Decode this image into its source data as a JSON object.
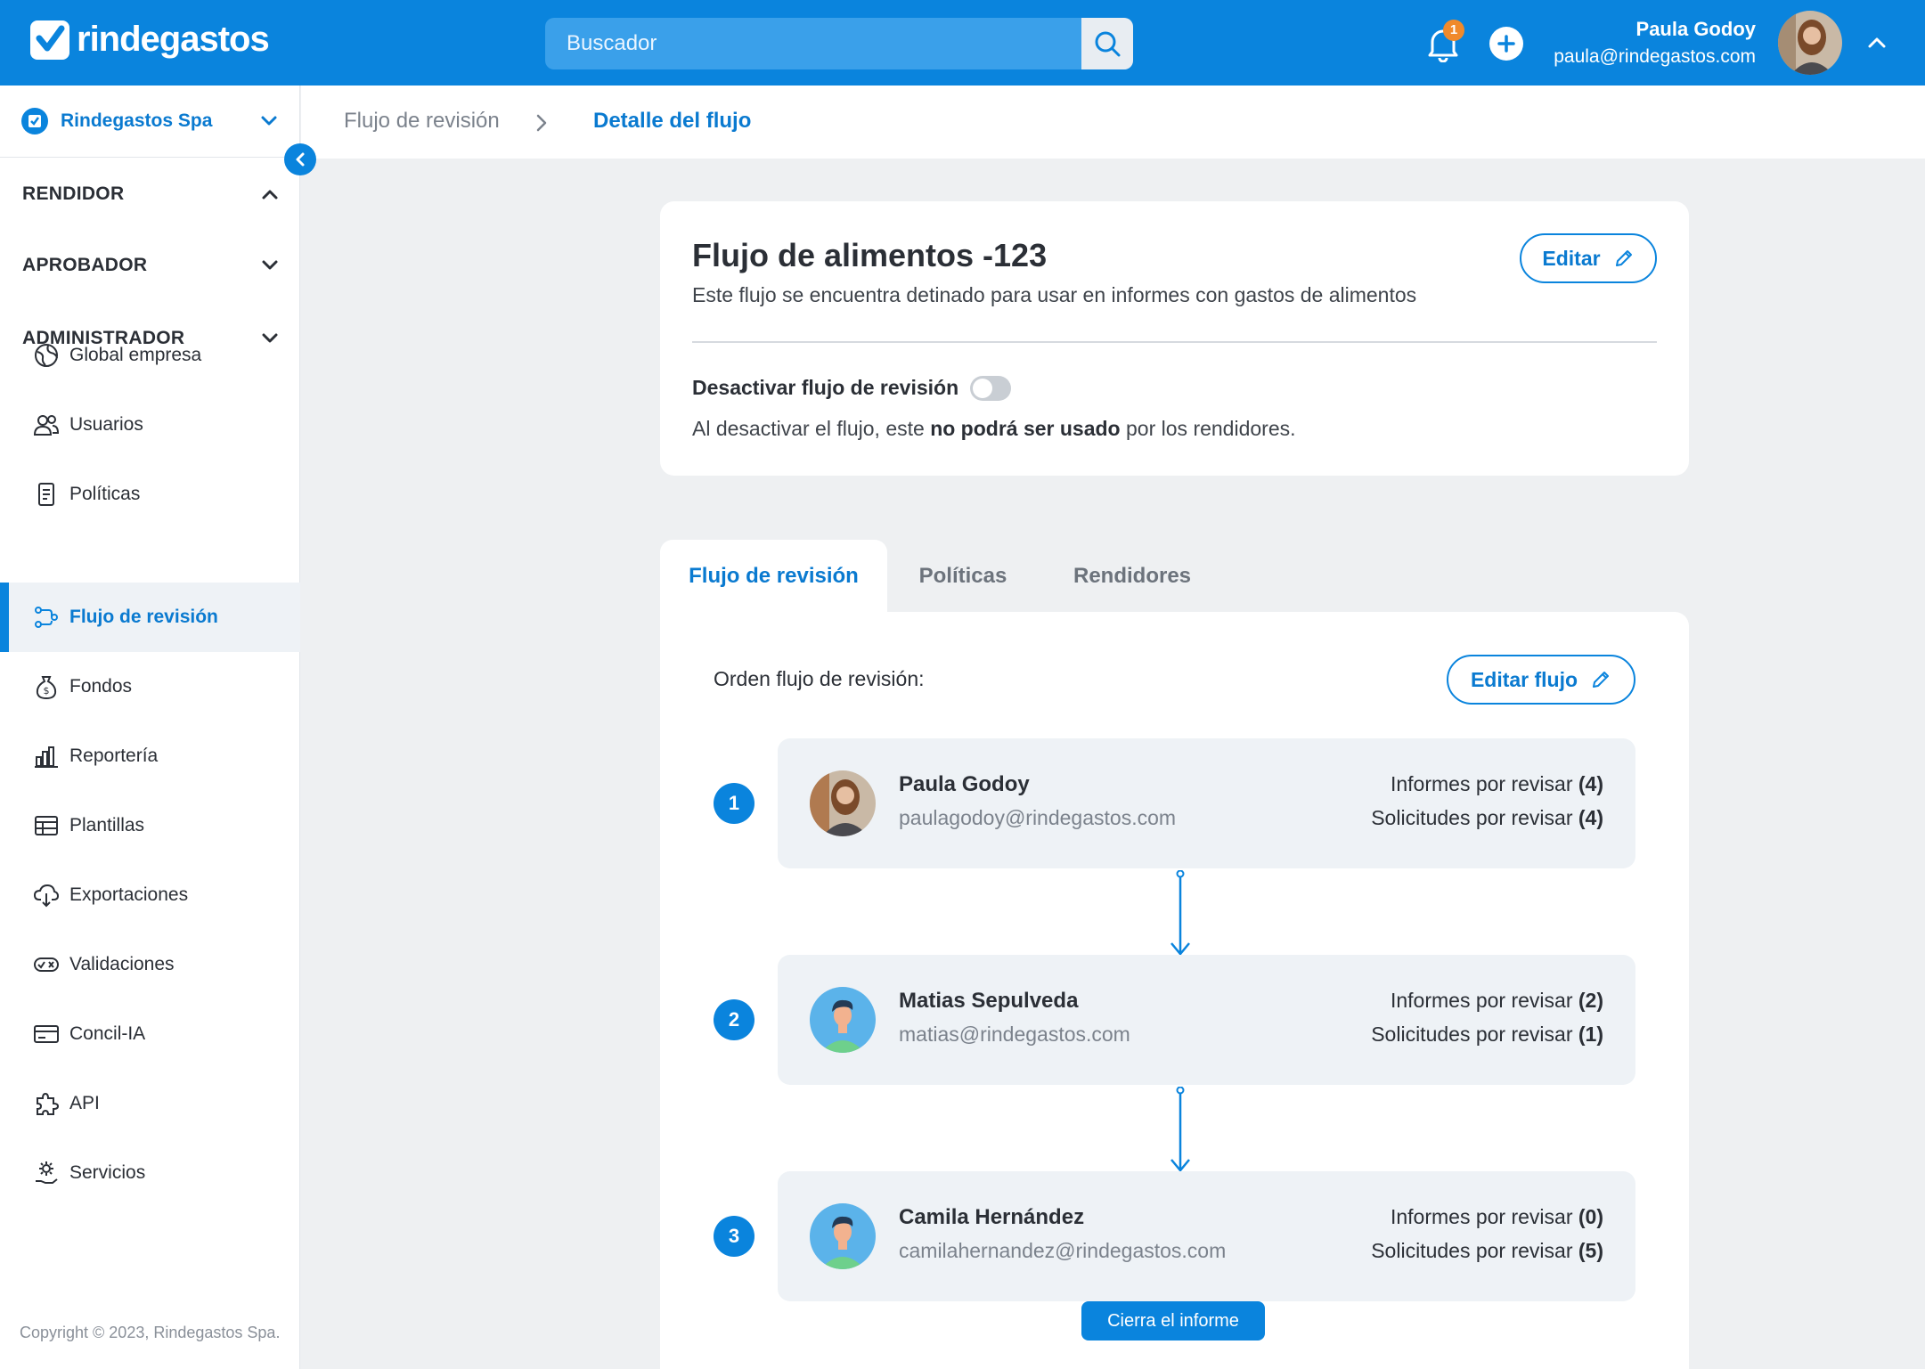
{
  "topbar": {
    "brand": "rindegastos",
    "search_placeholder": "Buscador",
    "notifications_count": "1",
    "user_name": "Paula Godoy",
    "user_email": "paula@rindegastos.com"
  },
  "sidebar": {
    "company": "Rindegastos Spa",
    "sections": {
      "rendidor": "RENDIDOR",
      "aprobador": "APROBADOR",
      "administrador": "ADMINISTRADOR"
    },
    "items": [
      {
        "label": "Global empresa",
        "icon": "globe-icon"
      },
      {
        "label": "Usuarios",
        "icon": "users-icon"
      },
      {
        "label": "Políticas",
        "icon": "document-icon"
      },
      {
        "label": "Flujo de revisión",
        "icon": "flow-icon",
        "active": true
      },
      {
        "label": "Fondos",
        "icon": "money-bag-icon"
      },
      {
        "label": "Reportería",
        "icon": "bar-chart-icon"
      },
      {
        "label": "Plantillas",
        "icon": "table-icon"
      },
      {
        "label": "Exportaciones",
        "icon": "cloud-download-icon"
      },
      {
        "label": "Validaciones",
        "icon": "check-x-icon"
      },
      {
        "label": "Concil-IA",
        "icon": "card-icon"
      },
      {
        "label": "API",
        "icon": "puzzle-icon"
      },
      {
        "label": "Servicios",
        "icon": "gear-hand-icon"
      }
    ],
    "copyright": "Copyright © 2023, Rindegastos Spa."
  },
  "breadcrumb": {
    "parent": "Flujo de revisión",
    "current": "Detalle del flujo"
  },
  "flow": {
    "title": "Flujo de alimentos -123",
    "description": "Este flujo se encuentra detinado para usar en informes con gastos de alimentos",
    "edit_label": "Editar",
    "deactivate_label": "Desactivar flujo de revisión",
    "deactivate_enabled": false,
    "note_before": "Al desactivar el flujo, este ",
    "note_bold": "no podrá ser usado",
    "note_after": " por los rendidores."
  },
  "tabs": [
    "Flujo de revisión",
    "Políticas",
    "Rendidores"
  ],
  "review": {
    "order_label": "Orden flujo de revisión:",
    "edit_flow_label": "Editar flujo",
    "informes_label": "Informes por revisar",
    "solicitudes_label": "Solicitudes por revisar",
    "steps": [
      {
        "num": "1",
        "name": "Paula Godoy",
        "email": "paulagodoy@rindegastos.com",
        "informes": "(4)",
        "solicitudes": "(4)"
      },
      {
        "num": "2",
        "name": "Matias Sepulveda",
        "email": "matias@rindegastos.com",
        "informes": "(2)",
        "solicitudes": "(1)"
      },
      {
        "num": "3",
        "name": "Camila Hernández",
        "email": "camilahernandez@rindegastos.com",
        "informes": "(0)",
        "solicitudes": "(5)"
      }
    ],
    "close_label": "Cierra el informe"
  },
  "colors": {
    "primary": "#0a84dd",
    "background": "#eef0f2",
    "badge": "#f08a2b"
  }
}
